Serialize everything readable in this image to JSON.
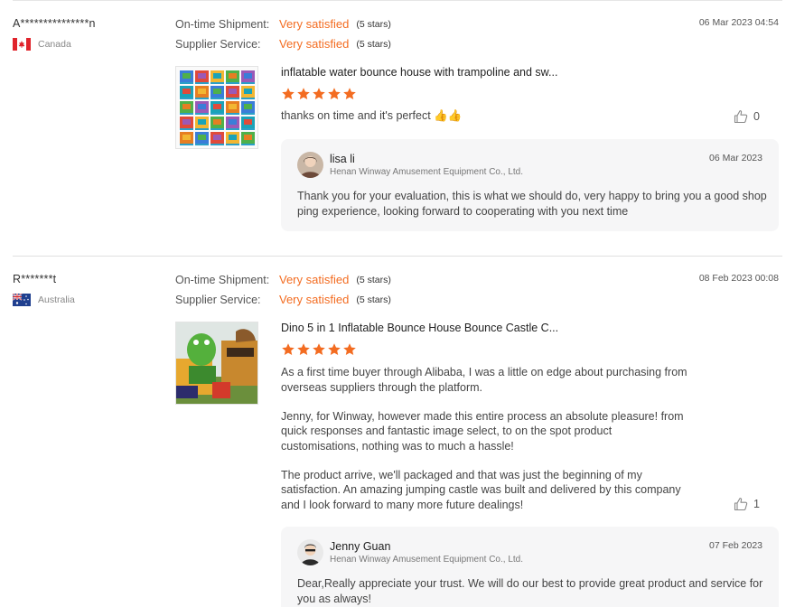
{
  "reviews": [
    {
      "buyer": "A***************n",
      "country": "Canada",
      "flag_icon": "canada-flag-icon",
      "date": "06 Mar 2023 04:54",
      "ratings": [
        {
          "label": "On-time Shipment:",
          "value": "Very satisfied",
          "stars": "(5 stars)"
        },
        {
          "label": "Supplier Service:",
          "value": "Very satisfied",
          "stars": "(5 stars)"
        }
      ],
      "product_title": "inflatable water bounce house with trampoline and sw...",
      "star_rating": 5,
      "comment": [
        "thanks on time and it's perfect 👍👍"
      ],
      "likes": "0",
      "reply": {
        "name": "lisa li",
        "company": "Henan Winway Amusement Equipment Co., Ltd.",
        "date": "06 Mar 2023",
        "text": "Thank you for your evaluation, this is what we should do, very happy to bring you a good shopping experience, looking forward to cooperating with you next time"
      }
    },
    {
      "buyer": "R*******t",
      "country": "Australia",
      "flag_icon": "australia-flag-icon",
      "date": "08 Feb 2023 00:08",
      "ratings": [
        {
          "label": "On-time Shipment:",
          "value": "Very satisfied",
          "stars": "(5 stars)"
        },
        {
          "label": "Supplier Service:",
          "value": "Very satisfied",
          "stars": "(5 stars)"
        }
      ],
      "product_title": "Dino 5 in 1 Inflatable Bounce House Bounce Castle C...",
      "star_rating": 5,
      "comment": [
        "As a first time buyer through Alibaba, I was a little on edge about purchasing from overseas suppliers through the platform.",
        "Jenny, for Winway, however made this entire process an absolute pleasure! from quick responses and fantastic image select, to on the spot product customisations, nothing was to much a hassle!",
        "The product arrive, we'll packaged and that was just the beginning of my satisfaction. An amazing jumping castle was built and delivered by this company and I look forward to many more future dealings!"
      ],
      "likes": "1",
      "reply": {
        "name": "Jenny Guan",
        "company": "Henan Winway Amusement Equipment Co., Ltd.",
        "date": "07 Feb 2023",
        "text": "Dear,Really appreciate your trust. We will do our best to provide great product and service for you as always!"
      }
    }
  ],
  "colors": {
    "accent": "#f36c21",
    "reply_bg": "#f6f6f7"
  }
}
